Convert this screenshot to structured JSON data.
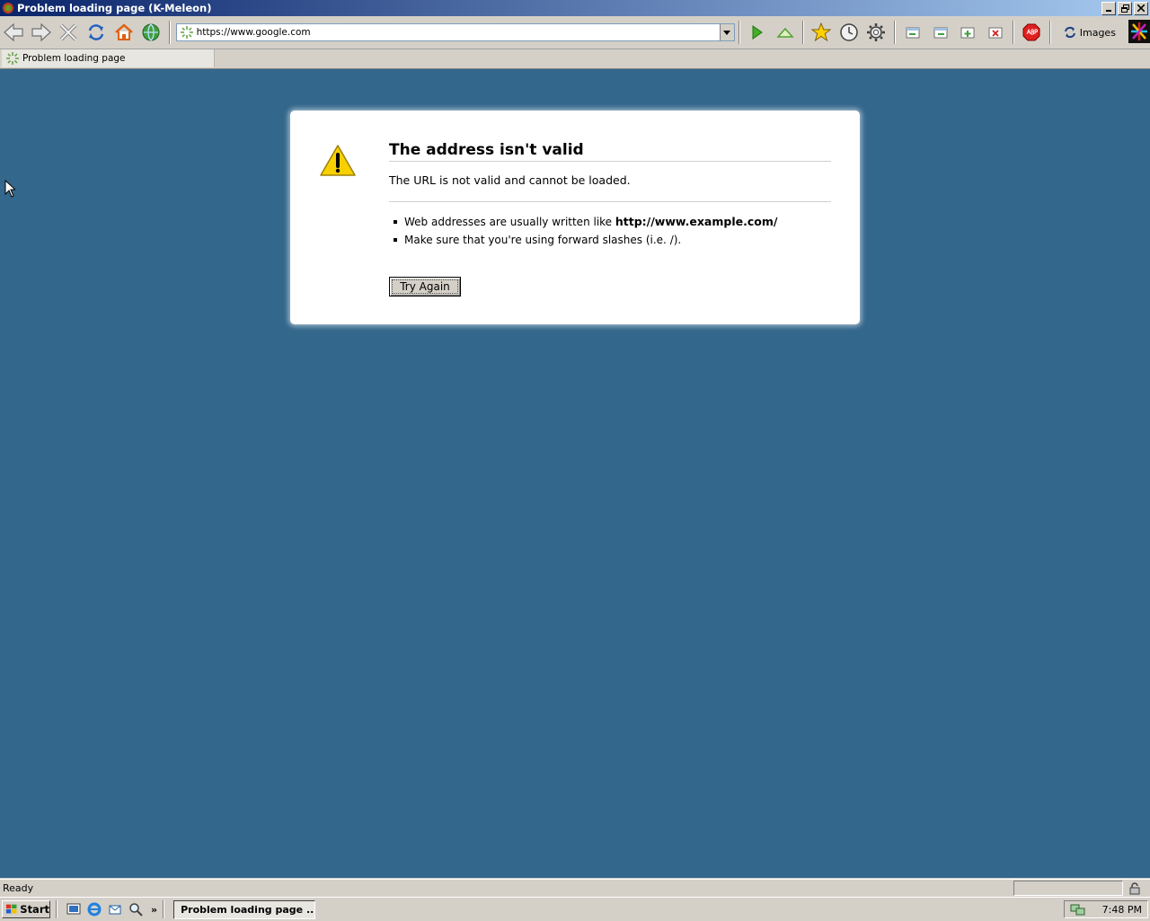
{
  "window": {
    "title": "Problem loading page (K-Meleon)"
  },
  "toolbar": {
    "url": "https://www.google.com",
    "images_label": "Images"
  },
  "tabs": [
    {
      "label": "Problem loading page"
    }
  ],
  "error": {
    "title": "The address isn't valid",
    "description": "The URL is not valid and cannot be loaded.",
    "bullet1_prefix": "Web addresses are usually written like ",
    "bullet1_example": "http://www.example.com/",
    "bullet2": "Make sure that you're using forward slashes (i.e. /).",
    "button": "Try Again"
  },
  "status": {
    "text": "Ready"
  },
  "taskbar": {
    "start_label": "Start",
    "task_label": "Problem loading page ...",
    "clock": "7:48 PM"
  },
  "colors": {
    "content_bg": "#33678c",
    "titlebar_start": "#0a246a",
    "titlebar_end": "#a6caf0"
  }
}
